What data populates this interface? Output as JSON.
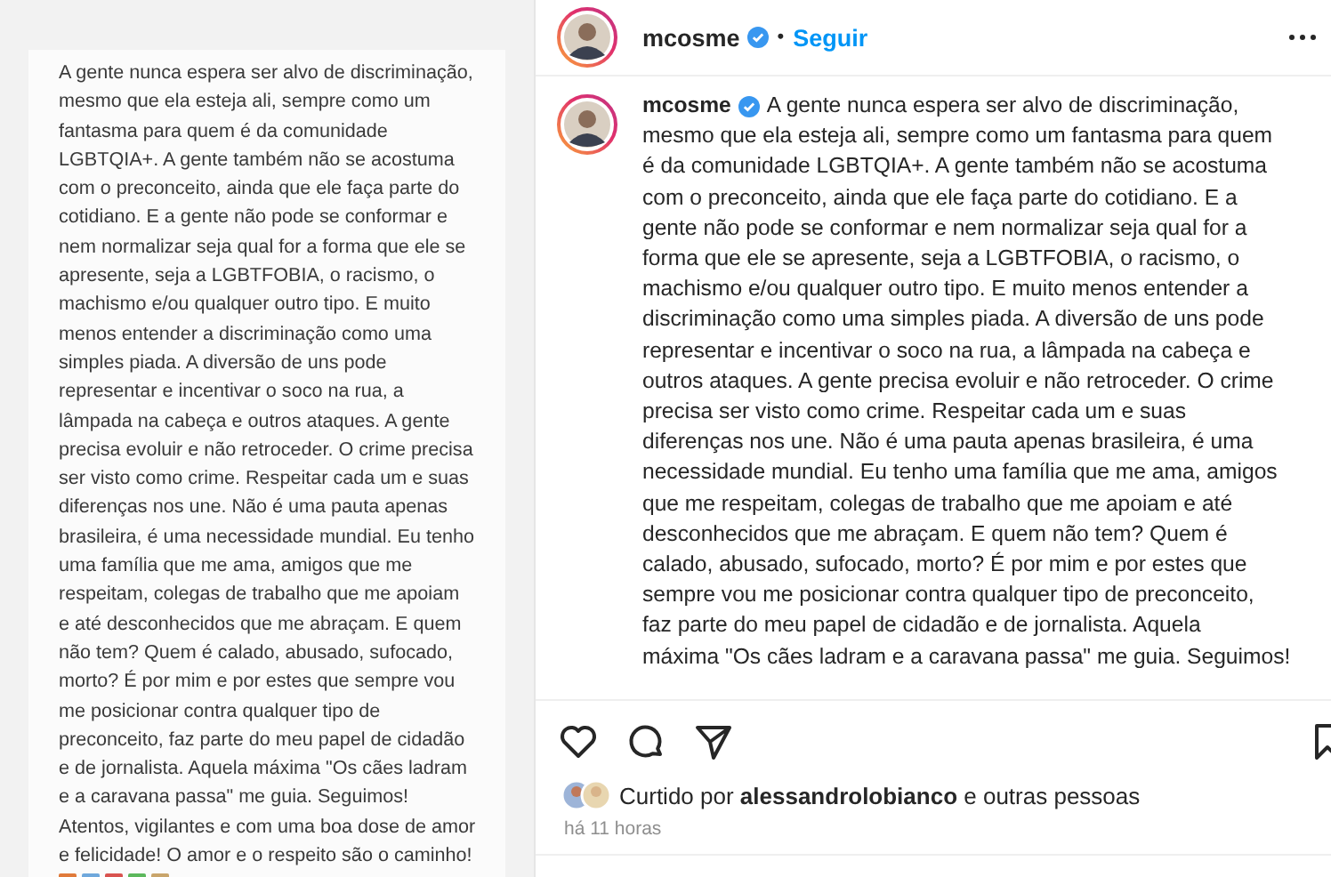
{
  "post_image": {
    "kind": "text-screenshot",
    "lines": [
      "A gente nunca espera ser alvo de discriminação,",
      "mesmo que ela esteja ali, sempre como um",
      "fantasma para quem é da comunidade",
      "LGBTQIA+. A gente também não se acostuma",
      "com o preconceito, ainda que ele faça parte do",
      "cotidiano. E a gente não pode se conformar e",
      "nem normalizar seja qual for a forma que ele se",
      "apresente, seja a LGBTFOBIA, o racismo, o",
      "machismo e/ou qualquer outro tipo. E muito",
      "menos entender a discriminação como uma",
      "simples piada. A diversão de uns pode",
      "representar e incentivar o soco na rua, a",
      "lâmpada na cabeça e outros ataques. A gente",
      "precisa evoluir e não retroceder. O crime precisa",
      "ser visto como crime. Respeitar cada um e suas",
      "diferenças nos une. Não é uma pauta apenas",
      "brasileira, é uma necessidade mundial. Eu tenho",
      "uma família que me ama, amigos que me",
      "respeitam, colegas de trabalho que me apoiam",
      "e até desconhecidos que me abraçam. E quem",
      "não tem? Quem é calado, abusado, sufocado,",
      "morto? É por mim e por estes que sempre vou",
      "me posicionar contra qualquer tipo de",
      "preconceito, faz parte do meu papel de cidadão",
      "e de jornalista. Aquela máxima  \"Os cães ladram",
      "e a caravana passa\" me guia. Seguimos!",
      "Atentos, vigilantes e com uma boa dose de amor",
      "e felicidade! O amor e o respeito são  o caminho!"
    ]
  },
  "header": {
    "username": "mcosme",
    "verified": true,
    "separator": "•",
    "follow": "Seguir"
  },
  "caption": {
    "username": "mcosme",
    "verified": true,
    "lines": [
      "A gente nunca espera ser alvo de discriminação,",
      "mesmo que ela esteja ali, sempre como um fantasma para quem",
      "é da comunidade LGBTQIA+. A gente também não se acostuma",
      "com o preconceito, ainda que ele faça parte do cotidiano. E a",
      "gente não pode se conformar e nem normalizar seja qual for a",
      "forma que ele se apresente, seja a LGBTFOBIA, o racismo, o",
      "machismo e/ou qualquer outro tipo. E muito menos entender a",
      "discriminação como uma simples piada. A diversão de uns pode",
      "representar e incentivar o soco na rua, a lâmpada na cabeça e",
      "outros ataques. A gente precisa evoluir e não retroceder. O crime",
      "precisa ser visto como crime. Respeitar cada um e suas",
      "diferenças nos une. Não é uma pauta apenas brasileira, é uma",
      "necessidade mundial. Eu tenho uma família que me ama, amigos",
      "que me respeitam, colegas de trabalho que me apoiam e até",
      "desconhecidos que me abraçam. E quem não tem? Quem é",
      "calado, abusado, sufocado, morto? É por mim e por estes que",
      "sempre vou me posicionar contra qualquer tipo de preconceito,",
      "faz parte do meu papel de cidadão e de jornalista. Aquela",
      "máxima \"Os cães ladram e a caravana passa\" me guia. Seguimos!"
    ]
  },
  "actions": {
    "liked": false,
    "saved": false
  },
  "likes": "Curtido por **alessandrolobianco** e outras pessoas",
  "time": "há 11 horas"
}
